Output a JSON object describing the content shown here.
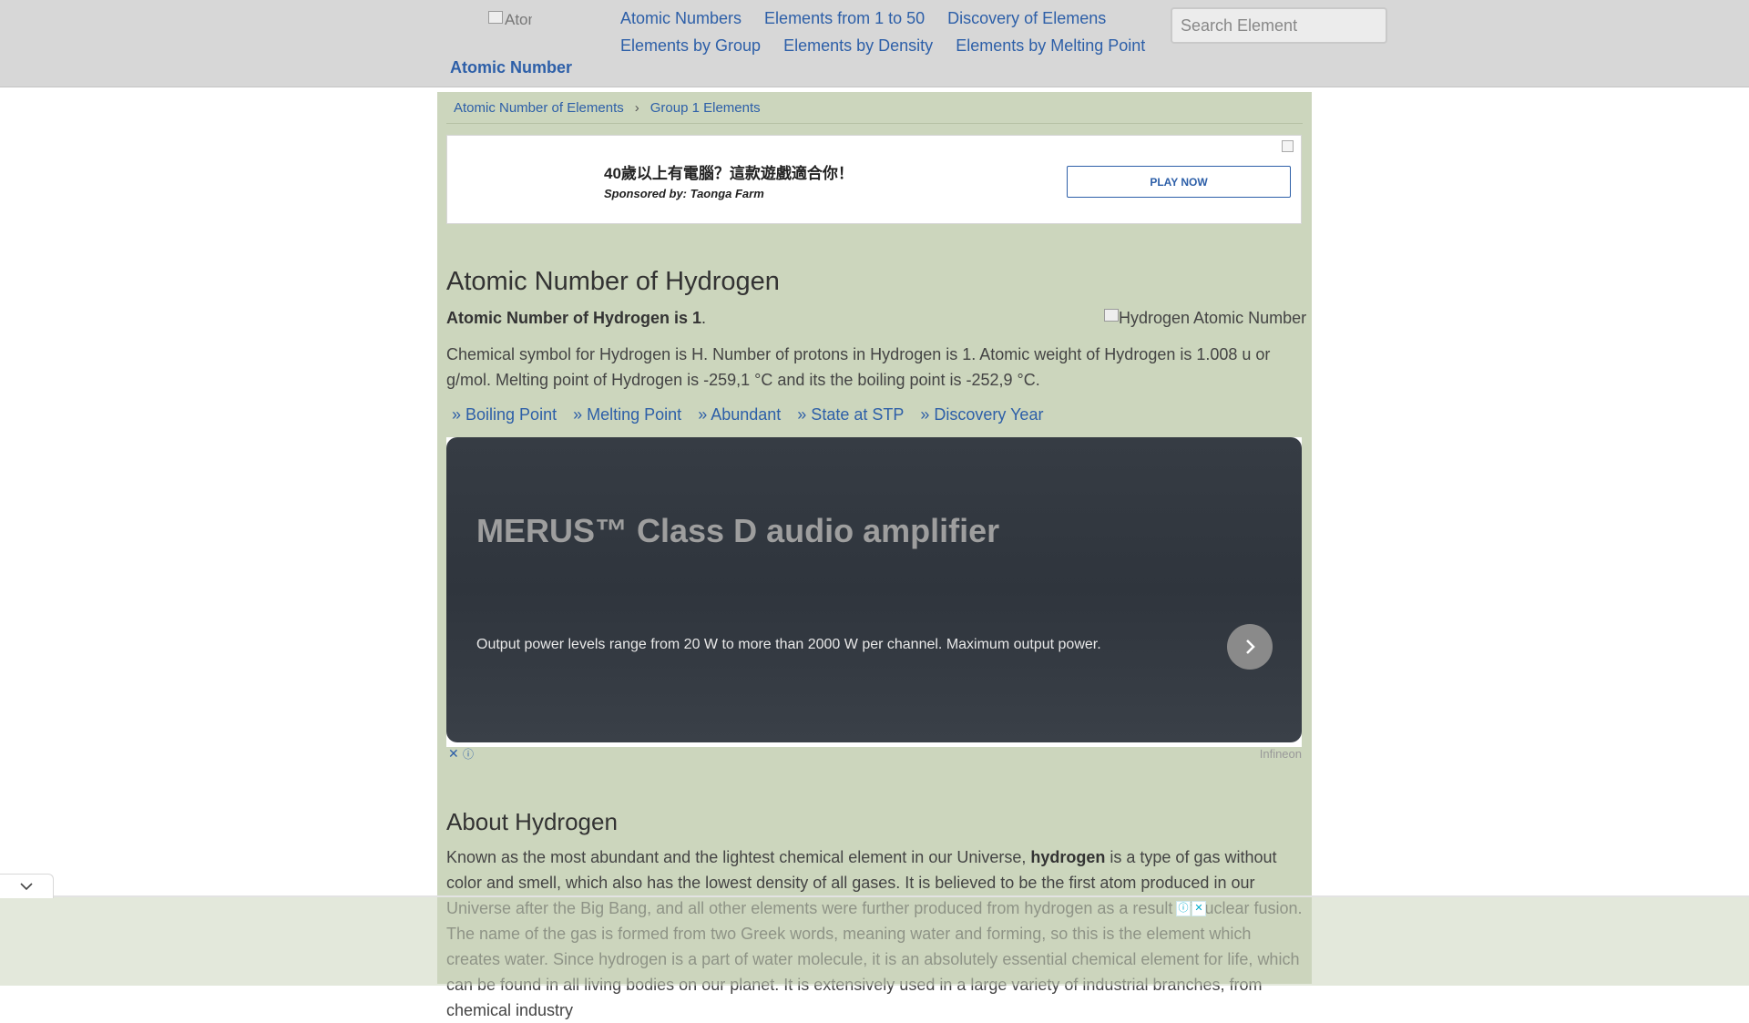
{
  "header": {
    "logo_alt": "Atomic",
    "logo_text": "Atomic Number",
    "nav_row1": [
      "Atomic Numbers",
      "Elements from 1 to 50",
      "Discovery of Elemens"
    ],
    "nav_row2": [
      "Elements by Group",
      "Elements by Density",
      "Elements by Melting Point"
    ],
    "search_placeholder": "Search Element"
  },
  "breadcrumb": {
    "items": [
      "Atomic Number of Elements",
      "Group 1 Elements"
    ],
    "separator": "›"
  },
  "ad1": {
    "title": "40歲以上有電腦？這款遊戲適合你！",
    "sponsor": "Sponsored by: Taonga Farm",
    "button": "PLAY NOW"
  },
  "article": {
    "title": "Atomic Number of Hydrogen",
    "lead_bold": "Atomic Number of Hydrogen is 1",
    "lead_end": ".",
    "image_alt": "Hydrogen Atomic Number",
    "para1": "Chemical symbol for Hydrogen is H. Number of protons in Hydrogen is 1. Atomic weight of Hydrogen is 1.008 u or g/mol. Melting point of Hydrogen is -259,1 °C and its the boiling point is -252,9 °C.",
    "links": [
      "» Boiling Point",
      "» Melting Point",
      "» Abundant",
      "» State at STP",
      "» Discovery Year"
    ]
  },
  "ad2": {
    "headline": "MERUS™ Class D audio amplifier",
    "description": "Output power levels range from 20 W to more than 2000 W per channel. Maximum output power.",
    "brand": "Infineon"
  },
  "about": {
    "title": "About Hydrogen",
    "text_before": "Known as the most abundant and the lightest chemical element in our Universe, ",
    "text_bold": "hydrogen",
    "text_after": " is a type of gas without color and smell, which also has the lowest density of all gases. It is believed to be the first atom produced in our Universe after the Big Bang, and all other elements were further produced from hydrogen as a result of nuclear fusion. The name of the gas is formed from two Greek words, meaning water and forming, so this is the element which creates water. Since hydrogen is a part of water molecule, it is an absolutely essential chemical element for life, which can be found in all living bodies on our planet. It is extensively used in a large variety of industrial branches, from chemical industry"
  },
  "colors": {
    "header_bg": "#d7d7d7",
    "main_bg": "#ccd6bd",
    "link": "#2d5fa8",
    "ad_card": "#363c44"
  }
}
